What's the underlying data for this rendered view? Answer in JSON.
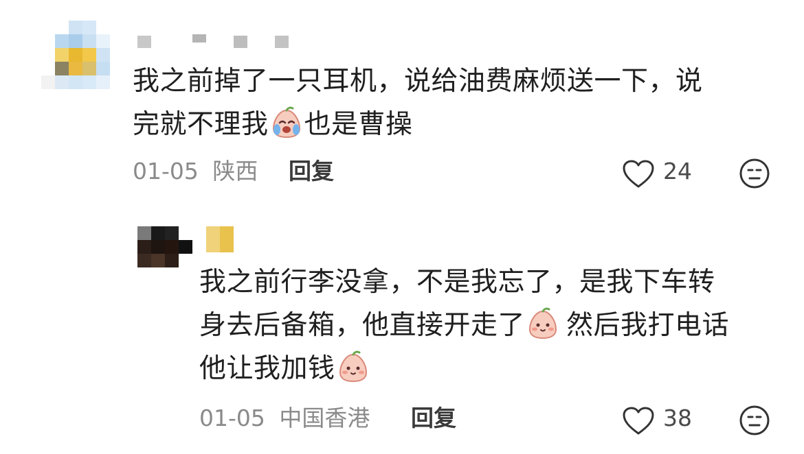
{
  "comment": {
    "text_line1": "我之前掉了一只耳机，说给油费麻烦送一下，说",
    "text_line2_before_emoji": "完就不理我",
    "text_line2_after_emoji": "也是曹操",
    "inline_emoji": "crying-face-emoji",
    "date": "01-05",
    "location": "陕西",
    "reply_label": "回复",
    "like_count": "24"
  },
  "reply": {
    "line1": "我之前行李没拿，不是我忘了，是我下车转",
    "line2_before_emoji": "身去后备箱，他直接开走了",
    "line2_after_emoji": "然后我打电话",
    "line3_before_emoji": "他让我加钱",
    "inline_emoji": "blushing-face-emoji",
    "date": "01-05",
    "location": "中国香港",
    "reply_label": "回复",
    "like_count": "38"
  },
  "colors": {
    "text": "#1f1f1f",
    "meta": "#8a8a8a",
    "emoji_fill": "#f7cdbf",
    "emoji_blush": "#f29a8c"
  }
}
